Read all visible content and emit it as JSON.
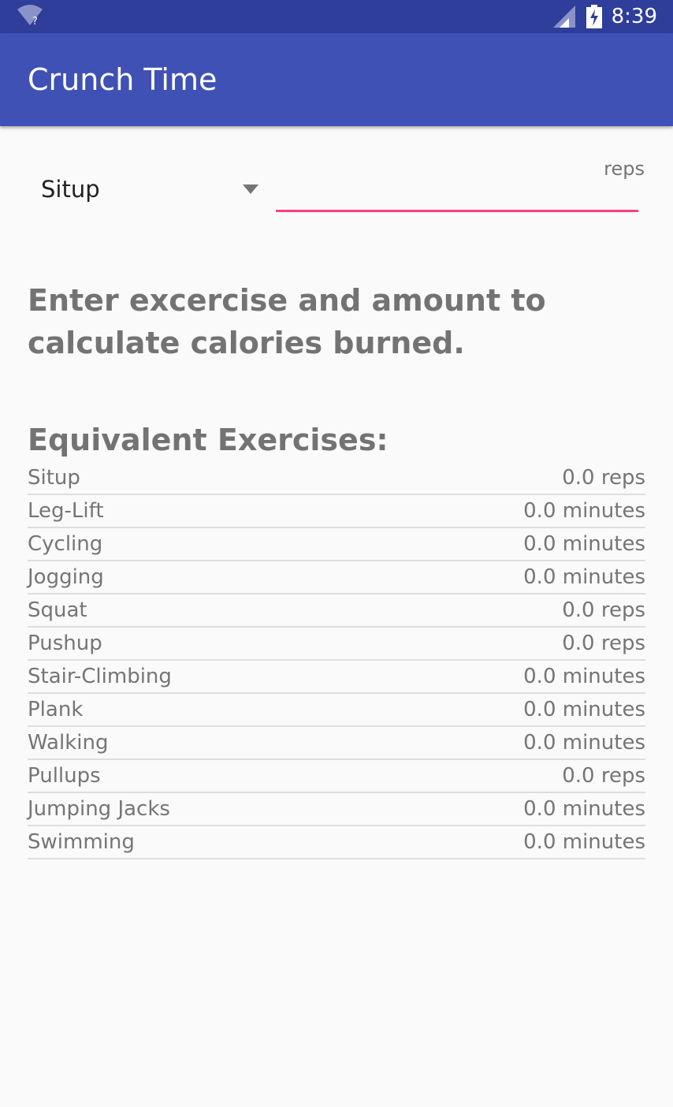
{
  "status_bar": {
    "time": "8:39",
    "wifi_icon": "wifi-unknown-icon",
    "signal_icon": "cell-signal-icon",
    "battery_icon": "battery-charging-icon"
  },
  "app_bar": {
    "title": "Crunch Time",
    "color": "#3f51b5"
  },
  "form": {
    "exercise_selected": "Situp",
    "amount_value": "",
    "amount_unit_hint": "reps",
    "accent_color": "#ff4081"
  },
  "instructions": "Enter excercise and amount to calculate calories burned.",
  "equivalents": {
    "title": "Equivalent Exercises:",
    "items": [
      {
        "name": "Situp",
        "value": "0.0 reps"
      },
      {
        "name": "Leg-Lift",
        "value": "0.0 minutes"
      },
      {
        "name": "Cycling",
        "value": "0.0 minutes"
      },
      {
        "name": "Jogging",
        "value": "0.0 minutes"
      },
      {
        "name": "Squat",
        "value": "0.0 reps"
      },
      {
        "name": "Pushup",
        "value": "0.0 reps"
      },
      {
        "name": "Stair-Climbing",
        "value": "0.0 minutes"
      },
      {
        "name": "Plank",
        "value": "0.0 minutes"
      },
      {
        "name": "Walking",
        "value": "0.0 minutes"
      },
      {
        "name": "Pullups",
        "value": "0.0 reps"
      },
      {
        "name": "Jumping Jacks",
        "value": "0.0 minutes"
      },
      {
        "name": "Swimming",
        "value": "0.0 minutes"
      }
    ]
  }
}
